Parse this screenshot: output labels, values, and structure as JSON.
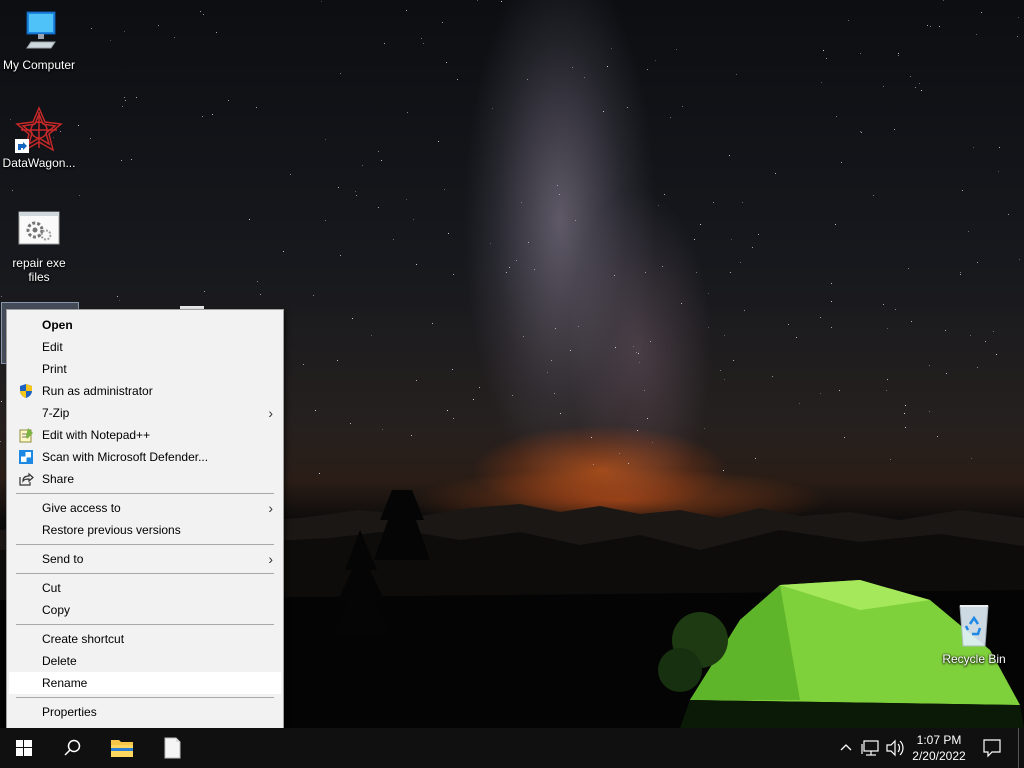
{
  "desktop": {
    "icons": [
      {
        "label": "My Computer",
        "icon": "computer-icon"
      },
      {
        "label": "DataWagon...",
        "icon": "datawagon-shortcut-icon"
      },
      {
        "label": "repair exe files",
        "icon": "settings-file-icon"
      },
      {
        "label": "Recycle Bin",
        "icon": "recycle-bin-icon"
      }
    ]
  },
  "context_menu": {
    "items": [
      {
        "label": "Open",
        "bold": true
      },
      {
        "label": "Edit"
      },
      {
        "label": "Print"
      },
      {
        "label": "Run as administrator",
        "icon": "uac-shield-icon"
      },
      {
        "label": "7-Zip",
        "submenu": true
      },
      {
        "label": "Edit with Notepad++",
        "icon": "notepad-plus-plus-icon"
      },
      {
        "label": "Scan with Microsoft Defender...",
        "icon": "defender-icon"
      },
      {
        "label": "Share",
        "icon": "share-icon"
      },
      {
        "label": "Give access to",
        "submenu": true
      },
      {
        "label": "Restore previous versions"
      },
      {
        "label": "Send to",
        "submenu": true
      },
      {
        "label": "Cut"
      },
      {
        "label": "Copy"
      },
      {
        "label": "Create shortcut"
      },
      {
        "label": "Delete"
      },
      {
        "label": "Rename",
        "highlighted": true
      },
      {
        "label": "Properties"
      }
    ]
  },
  "taskbar": {
    "time": "1:07 PM",
    "date": "2/20/2022"
  }
}
